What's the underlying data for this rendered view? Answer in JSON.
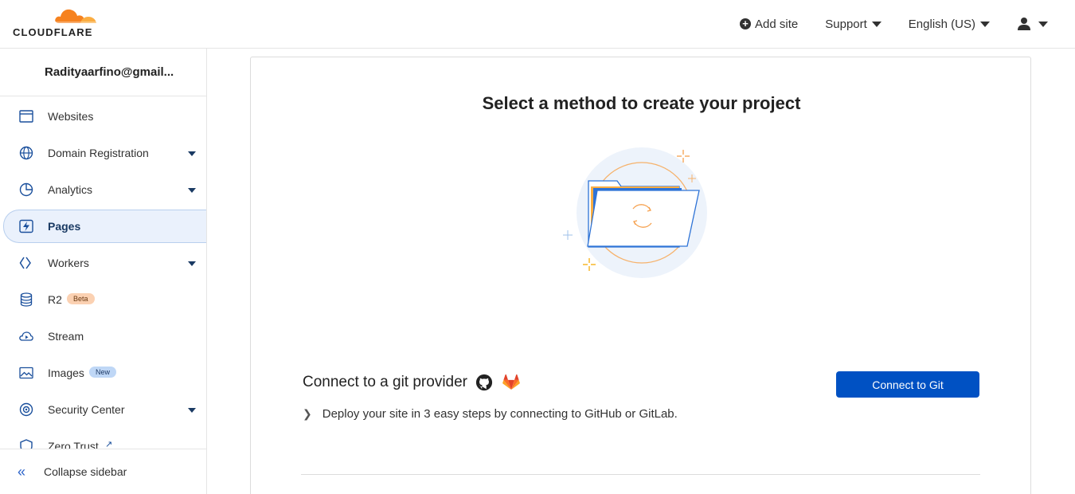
{
  "brand": {
    "name": "CLOUDFLARE",
    "accent": "#f6821f"
  },
  "header": {
    "add_site": "Add site",
    "support": "Support",
    "language": "English (US)"
  },
  "sidebar": {
    "account": "Radityaarfino@gmail...",
    "items": [
      {
        "label": "Websites",
        "icon": "browser-window-icon"
      },
      {
        "label": "Domain Registration",
        "icon": "globe-icon",
        "expandable": true
      },
      {
        "label": "Analytics",
        "icon": "pie-chart-icon",
        "expandable": true
      },
      {
        "label": "Pages",
        "icon": "lightning-bolt-icon",
        "active": true
      },
      {
        "label": "Workers",
        "icon": "workers-icon",
        "expandable": true
      },
      {
        "label": "R2",
        "icon": "database-icon",
        "badge": "Beta"
      },
      {
        "label": "Stream",
        "icon": "cloud-play-icon"
      },
      {
        "label": "Images",
        "icon": "image-icon",
        "badge": "New"
      },
      {
        "label": "Security Center",
        "icon": "security-center-icon",
        "expandable": true
      },
      {
        "label": "Zero Trust",
        "icon": "shield-icon",
        "external": true
      }
    ],
    "collapse": "Collapse sidebar"
  },
  "main": {
    "title": "Select a method to create your project",
    "git": {
      "heading": "Connect to a git provider",
      "description": "Deploy your site in 3 easy steps by connecting to GitHub or GitLab.",
      "button": "Connect to Git"
    }
  },
  "colors": {
    "primary_button": "#0051c3",
    "active_nav_bg": "#eaf1fc"
  }
}
